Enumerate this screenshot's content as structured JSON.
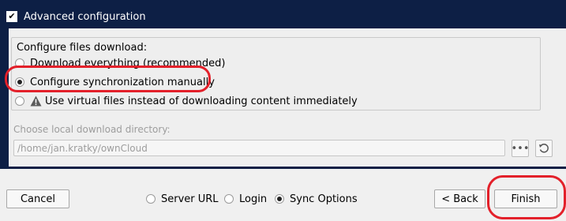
{
  "advanced": {
    "label": "Advanced configuration",
    "checked": true
  },
  "download": {
    "group_title": "Configure files download:",
    "options": [
      {
        "label": "Download everything (recommended)",
        "checked": false
      },
      {
        "label": "Configure synchronization manually",
        "checked": true
      },
      {
        "label": "Use virtual files instead of downloading content immediately",
        "checked": false,
        "icon": "warning-icon"
      }
    ]
  },
  "directory": {
    "label": "Choose local download directory:",
    "value": "/home/jan.kratky/ownCloud",
    "browse_icon": "more-icon",
    "reset_icon": "reset-icon"
  },
  "footer": {
    "cancel": "Cancel",
    "steps": [
      {
        "label": "Server URL",
        "selected": false
      },
      {
        "label": "Login",
        "selected": false
      },
      {
        "label": "Sync Options",
        "selected": true
      }
    ],
    "back": "< Back",
    "finish": "Finish"
  },
  "colors": {
    "header_bg": "#0d1f45",
    "annotation": "#e3202a"
  }
}
